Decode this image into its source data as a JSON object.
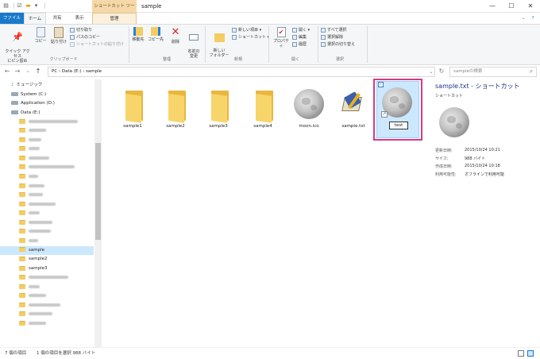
{
  "window": {
    "title": "sample",
    "context_tab_label": "ショートカット ツール",
    "controls": {
      "minimize": "—",
      "maximize": "☐",
      "close": "✕"
    }
  },
  "ribbon_tabs": {
    "file": "ファイル",
    "home": "ホーム",
    "share": "共有",
    "view": "表示",
    "manage": "管理"
  },
  "ribbon": {
    "clipboard": {
      "pin": "クイック アクセス\nにピン留め",
      "copy": "コピー",
      "paste": "貼り付け",
      "cut": "切り取り",
      "copy_path": "パスのコピー",
      "paste_shortcut": "ショートカットの貼り付け",
      "group": "クリップボード"
    },
    "organize": {
      "move_to": "移動先",
      "copy_to": "コピー先",
      "delete": "削除",
      "rename": "名前の\n変更",
      "group": "整理"
    },
    "new": {
      "new_folder": "新しい\nフォルダー",
      "new_item": "新しい項目 ▾",
      "shortcut": "ショートカット ▾",
      "group": "新規"
    },
    "open": {
      "properties": "プロパティ",
      "open": "開く ▾",
      "edit": "編集",
      "history": "履歴",
      "group": "開く"
    },
    "select": {
      "select_all": "すべて選択",
      "select_none": "選択解除",
      "invert": "選択の切り替え",
      "group": "選択"
    }
  },
  "address": {
    "path": "PC  ›  Data (E:)  ›  sample",
    "search_placeholder": "sampleの検索"
  },
  "nav": {
    "items": [
      {
        "label": "ミュージック",
        "kind": "music"
      },
      {
        "label": "System (C:)",
        "kind": "drive"
      },
      {
        "label": "Application (D:)",
        "kind": "drive"
      },
      {
        "label": "Data (E:)",
        "kind": "drive"
      },
      {
        "label": "",
        "kind": "folder-blur",
        "w": 62
      },
      {
        "label": "",
        "kind": "folder-blur",
        "w": 22
      },
      {
        "label": "",
        "kind": "folder-blur",
        "w": 16
      },
      {
        "label": "",
        "kind": "folder-blur",
        "w": 14
      },
      {
        "label": "",
        "kind": "folder-blur",
        "w": 26
      },
      {
        "label": "",
        "kind": "folder-blur",
        "w": 58
      },
      {
        "label": "",
        "kind": "folder-blur",
        "w": 12
      },
      {
        "label": "",
        "kind": "folder-blur",
        "w": 20
      },
      {
        "label": "",
        "kind": "folder-blur",
        "w": 18
      },
      {
        "label": "",
        "kind": "folder-blur",
        "w": 34
      },
      {
        "label": "",
        "kind": "folder-blur",
        "w": 14
      },
      {
        "label": "",
        "kind": "folder-blur",
        "w": 30
      },
      {
        "label": "",
        "kind": "folder-blur",
        "w": 28
      },
      {
        "label": "",
        "kind": "folder-blur",
        "w": 12
      },
      {
        "label": "sample",
        "kind": "folder",
        "selected": true
      },
      {
        "label": "sample2",
        "kind": "folder"
      },
      {
        "label": "sample3",
        "kind": "folder"
      },
      {
        "label": "",
        "kind": "folder-blur",
        "w": 50
      },
      {
        "label": "",
        "kind": "folder-blur",
        "w": 14
      },
      {
        "label": "",
        "kind": "folder-blur",
        "w": 22
      },
      {
        "label": "",
        "kind": "folder-blur",
        "w": 40
      },
      {
        "label": "",
        "kind": "folder-blur",
        "w": 30
      },
      {
        "label": "",
        "kind": "folder-blur",
        "w": 22
      }
    ]
  },
  "files": [
    {
      "name": "sample1",
      "type": "folder"
    },
    {
      "name": "sample2",
      "type": "folder"
    },
    {
      "name": "sample3",
      "type": "folder"
    },
    {
      "name": "sample4",
      "type": "folder"
    },
    {
      "name": "moon.ico",
      "type": "moon"
    },
    {
      "name": "sample.txt",
      "type": "txt"
    }
  ],
  "selected_file": {
    "rename_value": "test"
  },
  "preview": {
    "title": "sample.txt - ショートカット",
    "subtitle": "ショートカット",
    "props": [
      {
        "label": "更新日時:",
        "value": "2015/10/24 10:21"
      },
      {
        "label": "サイズ:",
        "value": "988 バイト"
      },
      {
        "label": "作成日時:",
        "value": "2015/10/24 10:18"
      },
      {
        "label": "利用可能性:",
        "value": "オフラインで利用可能"
      }
    ]
  },
  "status": {
    "count": "7 個の項目",
    "selection": "1 個の項目を選択  988 バイト"
  },
  "colors": {
    "accent": "#1979ca",
    "selection": "#cce8ff",
    "highlight_border": "#d63a83",
    "context_tab": "#f6d8a8"
  }
}
